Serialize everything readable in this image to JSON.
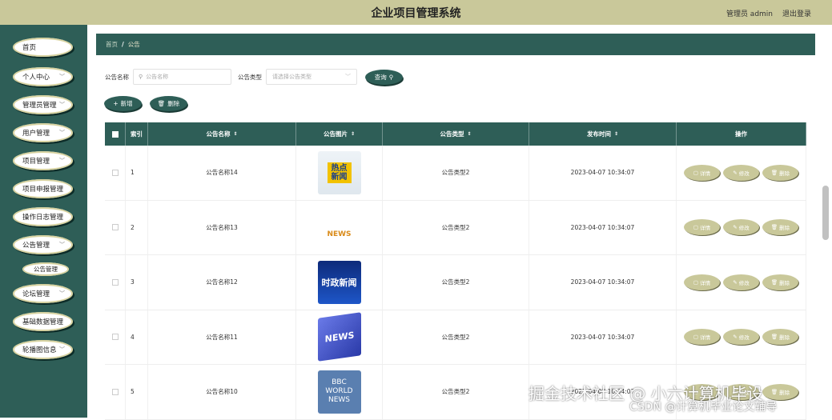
{
  "header": {
    "title": "企业项目管理系统",
    "user": "管理员 admin",
    "logout": "退出登录"
  },
  "sidebar": {
    "items": [
      {
        "label": "首页",
        "has_chevron": false
      },
      {
        "label": "个人中心",
        "has_chevron": true
      },
      {
        "label": "管理员管理",
        "has_chevron": true
      },
      {
        "label": "用户管理",
        "has_chevron": true
      },
      {
        "label": "项目管理",
        "has_chevron": true
      },
      {
        "label": "项目申报管理",
        "has_chevron": false
      },
      {
        "label": "操作日志管理",
        "has_chevron": false
      },
      {
        "label": "公告管理",
        "has_chevron": true
      },
      {
        "label": "论坛管理",
        "has_chevron": true
      },
      {
        "label": "基础数据管理",
        "has_chevron": false
      },
      {
        "label": "轮播图信息",
        "has_chevron": true
      }
    ],
    "submenu": {
      "label": "公告管理"
    }
  },
  "breadcrumb": {
    "home": "首页",
    "separator": "/",
    "current": "公告"
  },
  "search": {
    "name_label": "公告名称",
    "name_placeholder": "公告名称",
    "type_label": "公告类型",
    "type_placeholder": "请选择公告类型",
    "query_button": "查询"
  },
  "actions": {
    "add": "新增",
    "delete": "删除"
  },
  "table": {
    "headers": {
      "index": "索引",
      "name": "公告名称",
      "image": "公告图片",
      "type": "公告类型",
      "time": "发布时间",
      "ops": "操作"
    },
    "op_labels": {
      "detail": "详情",
      "edit": "修改",
      "delete": "删除"
    },
    "rows": [
      {
        "index": "1",
        "name": "公告名称14",
        "type": "公告类型2",
        "time": "2023-04-07 10:34:07",
        "image_text": "热点新闻"
      },
      {
        "index": "2",
        "name": "公告名称13",
        "type": "公告类型2",
        "time": "2023-04-07 10:34:07",
        "image_text": "NEWS"
      },
      {
        "index": "3",
        "name": "公告名称12",
        "type": "公告类型2",
        "time": "2023-04-07 10:34:07",
        "image_text": "时政新闻"
      },
      {
        "index": "4",
        "name": "公告名称11",
        "type": "公告类型2",
        "time": "2023-04-07 10:34:07",
        "image_text": "NEWS"
      },
      {
        "index": "5",
        "name": "公告名称10",
        "type": "公告类型2",
        "time": "2023-04-07 10:34:07",
        "image_text": "BBC WORLD NEWS"
      }
    ]
  },
  "watermark": {
    "line1": "掘金技术社区 @ 小六计算机毕设",
    "line2": "CSDN @计算机毕业论文辅导"
  },
  "colors": {
    "primary": "#2e5e57",
    "accent": "#c9c89a"
  }
}
